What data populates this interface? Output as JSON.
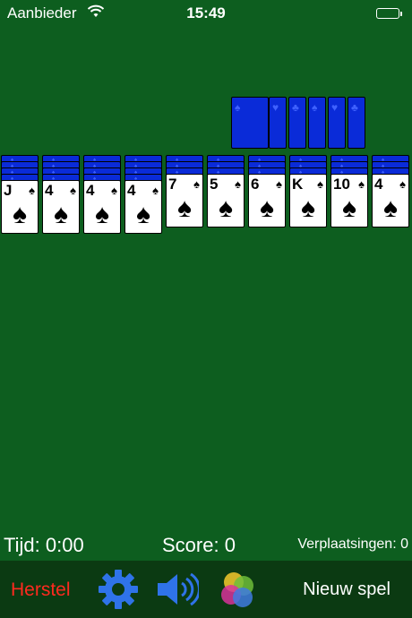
{
  "status_bar": {
    "carrier": "Aanbieder",
    "time": "15:49"
  },
  "stock": {
    "count": 6,
    "suit_glyphs": [
      "♠",
      "♥",
      "♣"
    ]
  },
  "tableau": [
    {
      "hidden": 4,
      "rank": "J",
      "suit": "♠"
    },
    {
      "hidden": 4,
      "rank": "4",
      "suit": "♠"
    },
    {
      "hidden": 4,
      "rank": "4",
      "suit": "♠"
    },
    {
      "hidden": 4,
      "rank": "4",
      "suit": "♠"
    },
    {
      "hidden": 3,
      "rank": "7",
      "suit": "♠"
    },
    {
      "hidden": 3,
      "rank": "5",
      "suit": "♠"
    },
    {
      "hidden": 3,
      "rank": "6",
      "suit": "♠"
    },
    {
      "hidden": 3,
      "rank": "K",
      "suit": "♠"
    },
    {
      "hidden": 3,
      "rank": "10",
      "suit": "♠"
    },
    {
      "hidden": 3,
      "rank": "4",
      "suit": "♠"
    }
  ],
  "info": {
    "time": "Tijd: 0:00",
    "score": "Score: 0",
    "moves": "Verplaatsingen: 0"
  },
  "toolbar": {
    "undo_label": "Herstel",
    "settings_icon": "gear-icon",
    "sound_icon": "speaker-icon",
    "game_center_icon": "game-center-icon",
    "new_game_label": "Nieuw spel"
  },
  "colors": {
    "felt": "#0d5e1f",
    "toolbar": "#0b3a12",
    "card_back": "#0a2bd8",
    "undo": "#ff2a1f",
    "icon_blue": "#2f73e8"
  }
}
